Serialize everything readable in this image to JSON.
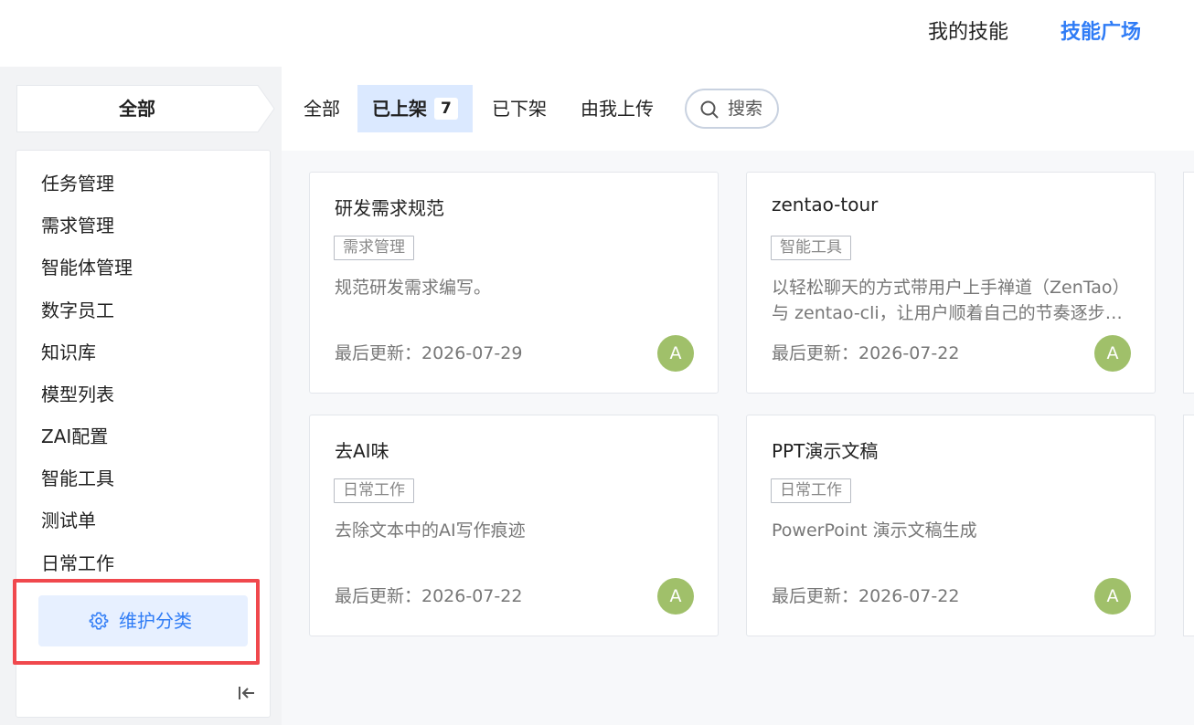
{
  "topbar": {
    "my_skills": "我的技能",
    "skill_plaza": "技能广场",
    "active_color": "#2f7cf6"
  },
  "category_head": "全部",
  "sidebar": {
    "items": [
      {
        "label": "任务管理"
      },
      {
        "label": "需求管理"
      },
      {
        "label": "智能体管理"
      },
      {
        "label": "数字员工"
      },
      {
        "label": "知识库"
      },
      {
        "label": "模型列表"
      },
      {
        "label": "ZAI配置"
      },
      {
        "label": "智能工具"
      },
      {
        "label": "测试单"
      },
      {
        "label": "日常工作"
      }
    ],
    "maintain_button": "维护分类",
    "maintain_icon": "gear-icon",
    "collapse_icon": "collapse-left-icon"
  },
  "tabs": {
    "all": "全部",
    "listed": "已上架",
    "listed_count": "7",
    "unlisted": "已下架",
    "uploaded_by_me": "由我上传",
    "search_placeholder": "搜索"
  },
  "cards": [
    {
      "title": "研发需求规范",
      "tag": "需求管理",
      "desc": "规范研发需求编写。",
      "updated": "最后更新：2026-07-29",
      "avatar": "A"
    },
    {
      "title": "zentao-tour",
      "tag": "智能工具",
      "desc": "以轻松聊天的方式带用户上手禅道（ZenTao）与 zentao-cli，让用户顺着自己的节奏逐步熟悉禅道的各项功能与命令行工具的使用方法。",
      "updated": "最后更新：2026-07-22",
      "avatar": "A"
    },
    {
      "title": "去AI味",
      "tag": "日常工作",
      "desc": "去除文本中的AI写作痕迹",
      "updated": "最后更新：2026-07-22",
      "avatar": "A"
    },
    {
      "title": "PPT演示文稿",
      "tag": "日常工作",
      "desc": "PowerPoint 演示文稿生成",
      "updated": "最后更新：2026-07-22",
      "avatar": "A"
    }
  ]
}
